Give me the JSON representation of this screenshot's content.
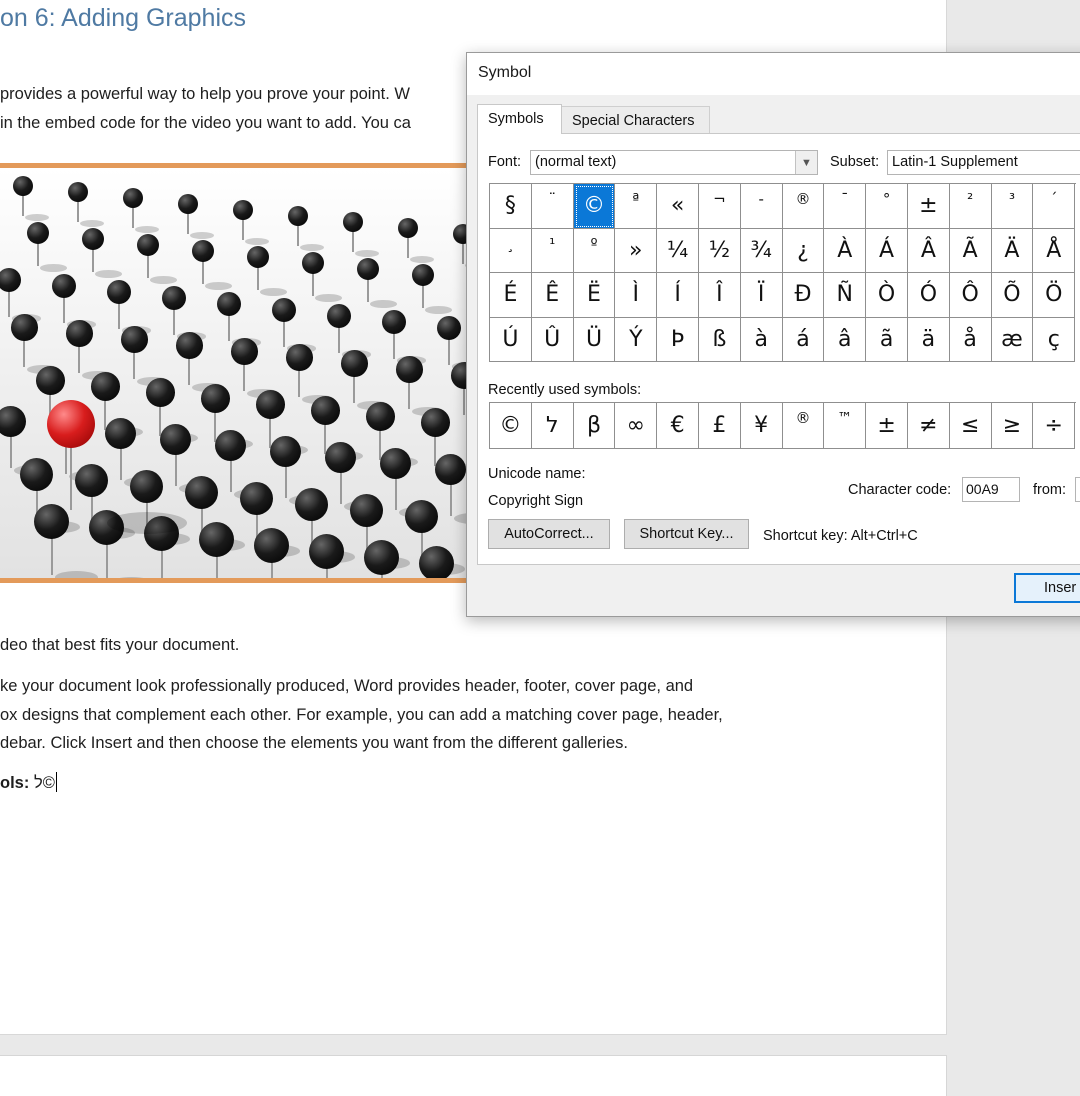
{
  "document": {
    "heading": "on 6: Adding Graphics",
    "para1_line1": "provides a powerful way to help you prove your point. W",
    "para1_line2": "in the embed code for the video you want to add. You ca",
    "para2": "deo that best fits your document.",
    "para3_line1": "ke your document look professionally produced, Word provides header, footer, cover page, and",
    "para3_line2": "ox designs that complement each other. For example, you can add a matching cover page, header,",
    "para3_line3": "debar. Click Insert and then choose the elements you want from the different galleries.",
    "symbols_label": "ols",
    "symbols_sep": ":",
    "symbols_value": " ל©"
  },
  "dialog": {
    "title": "Symbol",
    "tabs": [
      "Symbols",
      "Special Characters"
    ],
    "font_label": "Font:",
    "font_value": "(normal text)",
    "subset_label": "Subset:",
    "subset_value": "Latin-1 Supplement",
    "symbol_grid": [
      "§",
      "¨",
      "©",
      "ª",
      "«",
      "¬",
      "-",
      "®",
      "¯",
      "°",
      "±",
      "²",
      "³",
      "´",
      "¸",
      "¹",
      "º",
      "»",
      "¼",
      "½",
      "¾",
      "¿",
      "À",
      "Á",
      "Â",
      "Ã",
      "Ä",
      "Å",
      "É",
      "Ê",
      "Ë",
      "Ì",
      "Í",
      "Î",
      "Ï",
      "Ð",
      "Ñ",
      "Ò",
      "Ó",
      "Ô",
      "Õ",
      "Ö",
      "Ú",
      "Û",
      "Ü",
      "Ý",
      "Þ",
      "ß",
      "à",
      "á",
      "â",
      "ã",
      "ä",
      "å",
      "æ",
      "ç"
    ],
    "selected_symbol": "©",
    "recent_label": "Recently used symbols:",
    "recent_symbols": [
      "©",
      "ל",
      "β",
      "∞",
      "€",
      "£",
      "¥",
      "®",
      "™",
      "±",
      "≠",
      "≤",
      "≥",
      "÷"
    ],
    "unicode_name_label": "Unicode name:",
    "unicode_name_value": "Copyright Sign",
    "char_code_label": "Character code:",
    "char_code_value": "00A9",
    "from_label": "from:",
    "autocorrect_label": "AutoCorrect...",
    "shortcut_key_button": "Shortcut Key...",
    "shortcut_key_text": "Shortcut key: Alt+Ctrl+C",
    "insert_label": "Inser",
    "colors": {
      "selection": "#0b78d7",
      "heading": "#4f7aa3",
      "frame": "#e39a5a"
    }
  }
}
